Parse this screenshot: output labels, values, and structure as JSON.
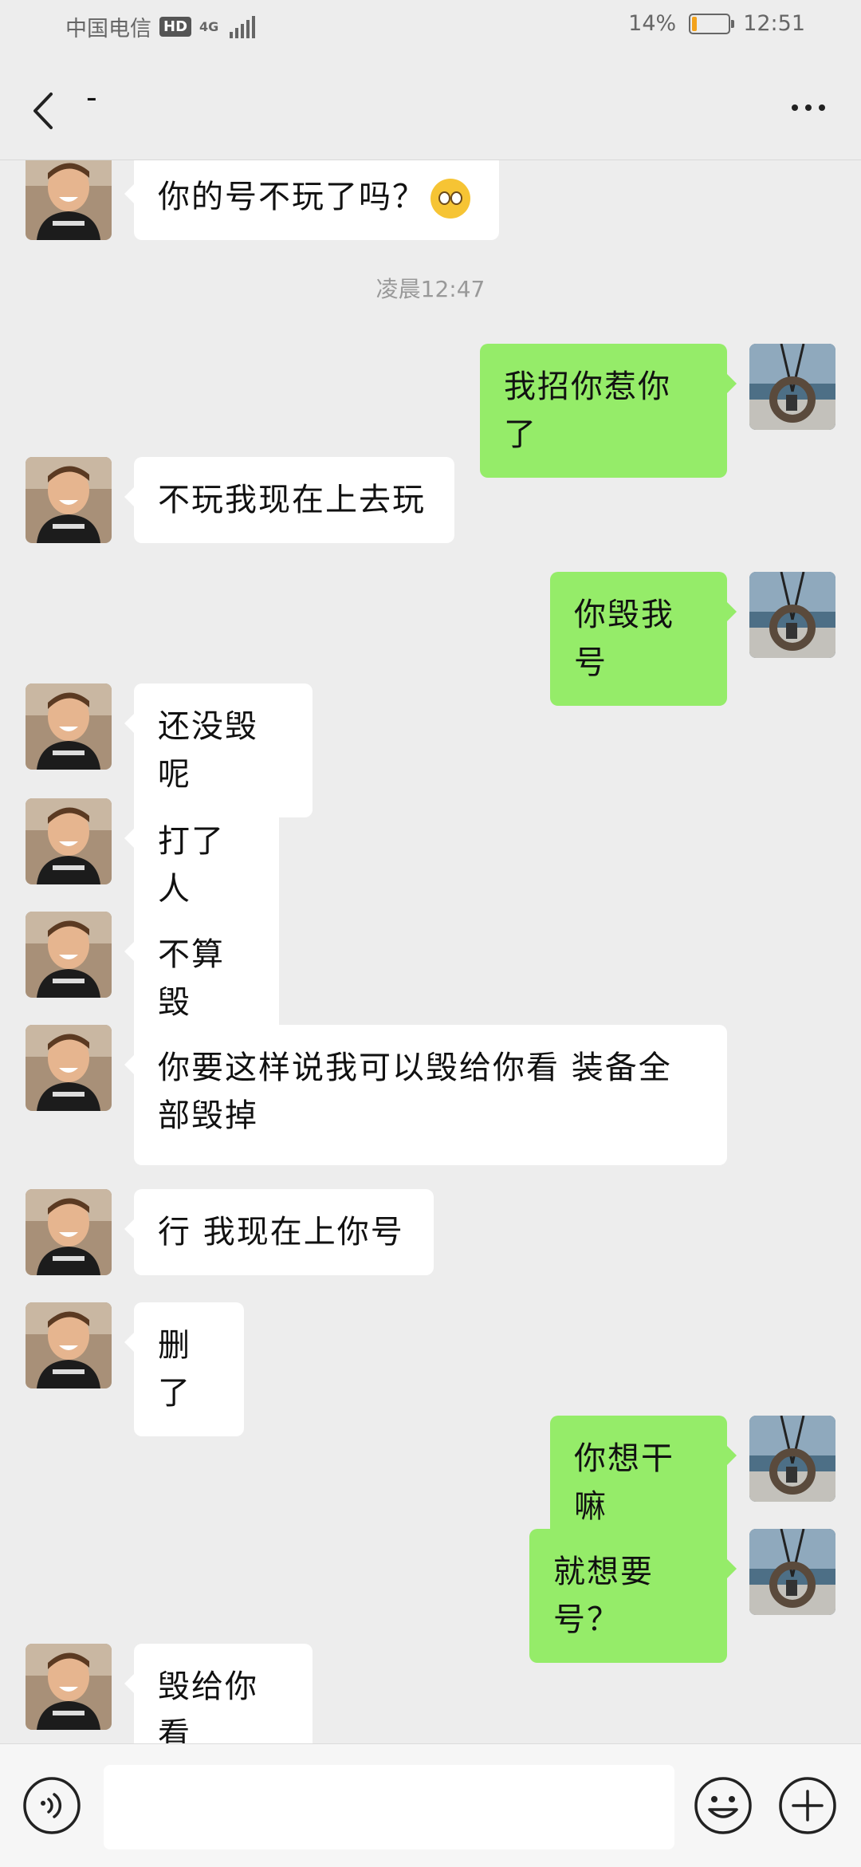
{
  "status_bar": {
    "carrier": "中国电信",
    "hd_badge": "HD",
    "network": "4G",
    "battery_percent_text": "14%",
    "battery_level": 0.14,
    "time": "12:51"
  },
  "header": {
    "title": "-",
    "back_icon": "chevron-left-icon",
    "more_icon": "more-dots-icon"
  },
  "messages": [
    {
      "side": "friend",
      "text": "你的号不玩了吗？",
      "emoji": "pleading-face-emoji"
    },
    {
      "type": "timestamp",
      "text": "凌晨12:47"
    },
    {
      "side": "me",
      "text": "我招你惹你了"
    },
    {
      "side": "friend",
      "text": "不玩我现在上去玩"
    },
    {
      "side": "me",
      "text": "你毁我号"
    },
    {
      "side": "friend",
      "text": "还没毁呢"
    },
    {
      "side": "friend",
      "text": "打了人"
    },
    {
      "side": "friend",
      "text": "不算毁"
    },
    {
      "side": "friend",
      "text": "你要这样说我可以毁给你看   装备全部毁掉"
    },
    {
      "side": "friend",
      "text": "行  我现在上你号"
    },
    {
      "side": "friend",
      "text": "删了"
    },
    {
      "side": "me",
      "text": "你想干嘛"
    },
    {
      "side": "me",
      "text": "就想要号？"
    },
    {
      "side": "friend",
      "text": "毁给你看"
    }
  ],
  "input_bar": {
    "voice_icon": "voice-icon",
    "input_value": "",
    "emoji_icon": "emoji-icon",
    "plus_icon": "plus-icon"
  },
  "colors": {
    "background": "#ededed",
    "my_bubble": "#95ec69",
    "friend_bubble": "#ffffff",
    "battery_low": "#f3a21b"
  }
}
